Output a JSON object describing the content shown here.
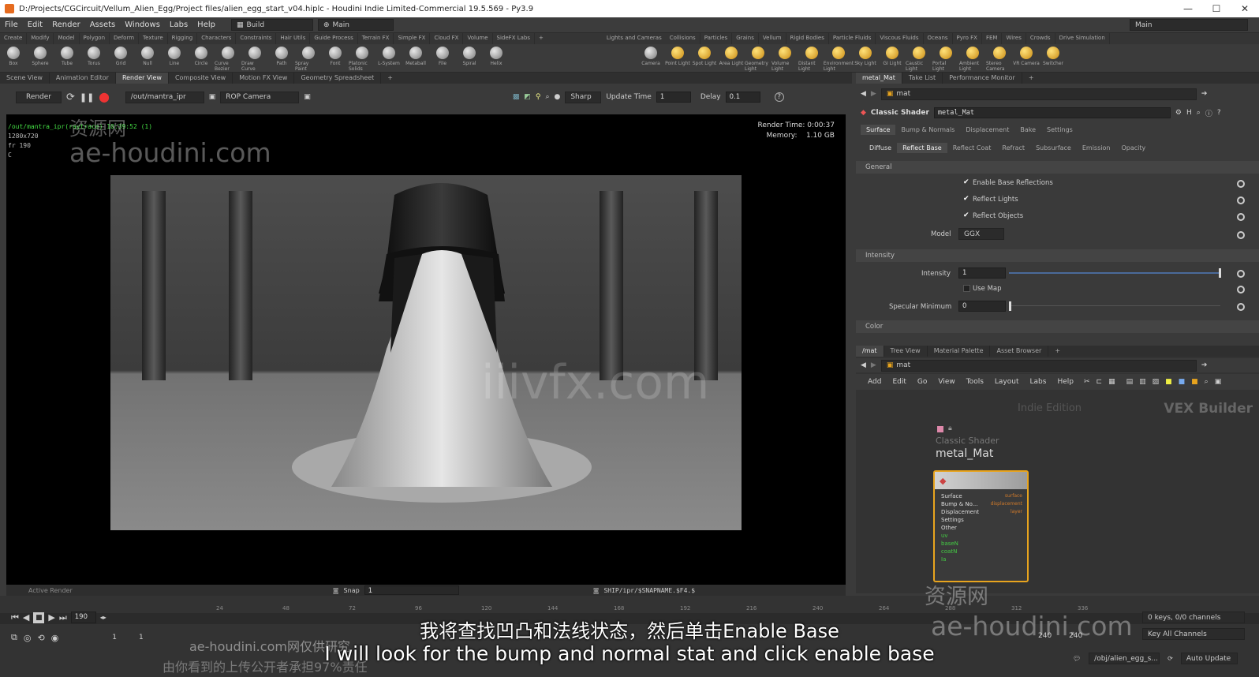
{
  "title_bar": {
    "text": "D:/Projects/CGCircuit/Vellum_Alien_Egg/Project files/alien_egg_start_v04.hiplc - Houdini Indie Limited-Commercial 19.5.569 - Py3.9",
    "min": "—",
    "max": "☐",
    "close": "✕"
  },
  "menu": [
    "File",
    "Edit",
    "Render",
    "Assets",
    "Windows",
    "Labs",
    "Help"
  ],
  "desk": {
    "build": "Build",
    "main_left": "Main",
    "main_right": "Main"
  },
  "shelf_tabs_left": [
    "Create",
    "Modify",
    "Model",
    "Polygon",
    "Deform",
    "Texture",
    "Rigging",
    "Characters",
    "Constraints",
    "Hair Utils",
    "Guide Process",
    "Terrain FX",
    "Simple FX",
    "Cloud FX",
    "Volume",
    "SideFX Labs"
  ],
  "shelf_tabs_right": [
    "Lights and Cameras",
    "Collisions",
    "Particles",
    "Grains",
    "Vellum",
    "Rigid Bodies",
    "Particle Fluids",
    "Viscous Fluids",
    "Oceans",
    "Pyro FX",
    "FEM",
    "Wires",
    "Crowds",
    "Drive Simulation"
  ],
  "tools_left": [
    "Box",
    "Sphere",
    "Tube",
    "Torus",
    "Grid",
    "Null",
    "Line",
    "Circle",
    "Curve Bezier",
    "Draw Curve",
    "Path",
    "Spray Paint",
    "Font",
    "Platonic Solids",
    "L-System",
    "Metaball",
    "File",
    "Spiral",
    "Helix"
  ],
  "tools_right": [
    "Camera",
    "Point Light",
    "Spot Light",
    "Area Light",
    "Geometry Light",
    "Volume Light",
    "Distant Light",
    "Environment Light",
    "Sky Light",
    "GI Light",
    "Caustic Light",
    "Portal Light",
    "Ambient Light",
    "Stereo Camera",
    "VR Camera",
    "Switcher"
  ],
  "viewer_tabs": [
    "Scene View",
    "Animation Editor",
    "Render View",
    "Composite View",
    "Motion FX View",
    "Geometry Spreadsheet"
  ],
  "render_toolbar": {
    "render": "Render",
    "rop": "/out/mantra_ipr",
    "camera": "ROP Camera",
    "sharp": "Sharp",
    "update_label": "Update Time",
    "update_val": "1",
    "delay_label": "Delay",
    "delay_val": "0.1",
    "help": "?"
  },
  "render_info": {
    "path": "/out/mantra_ipr(raytrace) 10:39:52 (1)",
    "res": "1280x720",
    "frame": "fr 190",
    "c": "C",
    "time": "Render Time: 0:00:37",
    "memory_label": "Memory:",
    "memory": "1.10 GB"
  },
  "viewer_footer": {
    "active": "Active Render",
    "snap": "Snap",
    "snap_val": "1",
    "ship": "SHIP/ipr/$SNAPNAME.$F4.$"
  },
  "right_tabs": [
    "metal_Mat",
    "Take List",
    "Performance Monitor"
  ],
  "params": {
    "path": "mat",
    "shader_type": "Classic Shader",
    "shader_name": "metal_Mat",
    "main_tabs": [
      "Surface",
      "Bump & Normals",
      "Displacement",
      "Bake",
      "Settings"
    ],
    "sub_tabs": [
      "Diffuse",
      "Reflect Base",
      "Reflect Coat",
      "Refract",
      "Subsurface",
      "Emission",
      "Opacity"
    ],
    "general": "General",
    "enable_base": "Enable Base Reflections",
    "reflect_lights": "Reflect Lights",
    "reflect_objects": "Reflect Objects",
    "model_label": "Model",
    "model_val": "GGX",
    "intensity_hdr": "Intensity",
    "intensity_label": "Intensity",
    "intensity_val": "1",
    "use_map": "Use Map",
    "spec_min_label": "Specular Minimum",
    "spec_min_val": "0",
    "color_hdr": "Color"
  },
  "net_tabs": [
    "/mat",
    "Tree View",
    "Material Palette",
    "Asset Browser"
  ],
  "net": {
    "path": "mat",
    "menu": [
      "Add",
      "Edit",
      "Go",
      "View",
      "Tools",
      "Layout",
      "Labs",
      "Help"
    ],
    "indie": "Indie Edition",
    "vex": "VEX Builder",
    "node_type": "Classic Shader",
    "node_name": "metal_Mat",
    "node_inputs": [
      "Surface",
      "Bump & No...",
      "Displacement",
      "Settings",
      "Other",
      "uv",
      "baseN",
      "coatN",
      "Ia"
    ],
    "node_outputs": [
      "surface",
      "displacement",
      "layer"
    ]
  },
  "timeline": {
    "frame": "190",
    "start": "1",
    "start2": "1",
    "end": "240",
    "end2": "240",
    "ticks": [
      "24",
      "48",
      "72",
      "96",
      "120",
      "144",
      "168",
      "192",
      "216",
      "240",
      "264",
      "288",
      "312",
      "336"
    ],
    "keys": "0 keys, 0/0 channels",
    "key_all": "Key All Channels",
    "obj": "/obj/alien_egg_s...",
    "auto": "Auto Update"
  },
  "watermarks": {
    "cn1": "资源网",
    "en1": "ae-houdini.com",
    "cn2": "资源网",
    "en2": "ae-houdini.com",
    "center": "iiivfx.com",
    "small1": "ae-houdini.com网仅供研究",
    "small2": "由你看到的上传公开者承担97%责任"
  },
  "subtitles": {
    "zh": "我将查找凹凸和法线状态，然后单击Enable Base",
    "en": "I will look for the bump and normal stat and click enable base"
  }
}
